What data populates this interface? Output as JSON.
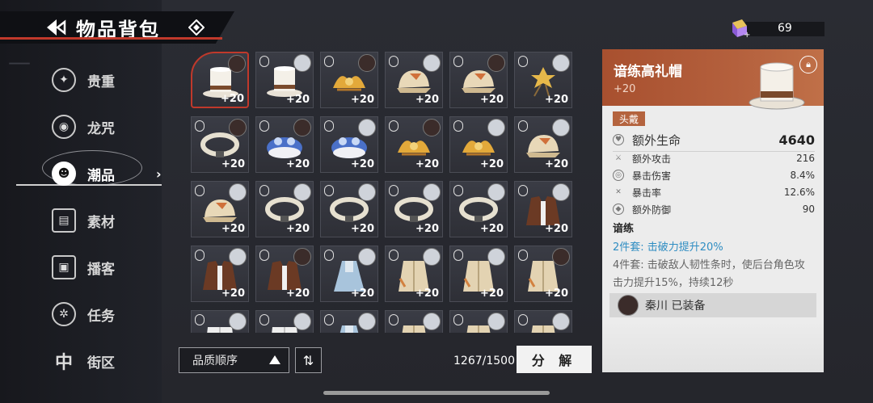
{
  "header": {
    "title": "物品背包"
  },
  "currency": {
    "value": "69"
  },
  "sidebar": {
    "items": [
      {
        "label": "贵重",
        "icon": "star-icon"
      },
      {
        "label": "龙咒",
        "icon": "ring-icon"
      },
      {
        "label": "潮品",
        "icon": "fashion-icon"
      },
      {
        "label": "素材",
        "icon": "box-icon"
      },
      {
        "label": "播客",
        "icon": "tape-icon"
      },
      {
        "label": "任务",
        "icon": "reel-icon"
      },
      {
        "label": "街区",
        "icon": "district-icon"
      }
    ],
    "active_index": 2
  },
  "grid": {
    "level_label": "+20",
    "rows": [
      [
        "top-hat",
        "top-hat",
        "crown",
        "cap",
        "cap",
        "hairpin"
      ],
      [
        "collar",
        "beanie",
        "beanie",
        "crown",
        "crown",
        "cap"
      ],
      [
        "cap",
        "collar",
        "collar",
        "collar",
        "collar",
        "coat"
      ],
      [
        "coat",
        "coat",
        "dress",
        "trench",
        "trench",
        "trench"
      ],
      [
        "shirt",
        "shirt",
        "dress",
        "trench",
        "trench",
        "trench"
      ]
    ]
  },
  "bottom": {
    "sort_label": "品质顺序",
    "capacity": "1267/1500",
    "split_label": "分 解"
  },
  "detail": {
    "name": "谙练高礼帽",
    "level": "+20",
    "slot": "头戴",
    "main_stat": {
      "label": "额外生命",
      "value": "4640"
    },
    "stats": [
      {
        "label": "额外攻击",
        "value": "216"
      },
      {
        "label": "暴击伤害",
        "value": "8.4%"
      },
      {
        "label": "暴击率",
        "value": "12.6%"
      },
      {
        "label": "额外防御",
        "value": "90"
      }
    ],
    "set_name": "谙练",
    "set2": "2件套: 击破力提升20%",
    "set4": "4件套: 击破敌人韧性条时，使后台角色攻击力提升15%，持续12秒",
    "equipped_by": "秦川 已装备"
  },
  "colors": {
    "accent": "#b4603d",
    "set_blue": "#2f8dc2",
    "selected_border": "#c0392b"
  }
}
